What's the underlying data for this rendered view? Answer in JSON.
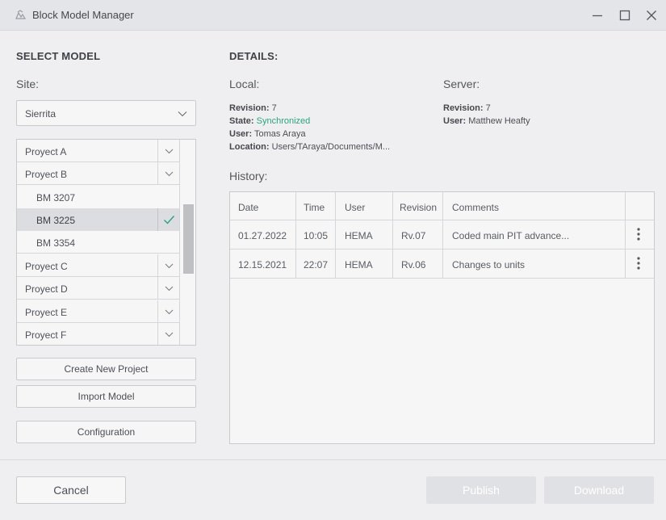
{
  "window": {
    "title": "Block Model Manager"
  },
  "select_model": {
    "heading": "SELECT MODEL",
    "site_label": "Site:",
    "site_value": "Sierrita",
    "tree": [
      {
        "label": "Proyect A",
        "kind": "project"
      },
      {
        "label": "Proyect B",
        "kind": "project",
        "expanded": true
      },
      {
        "label": "BM 3207",
        "kind": "model"
      },
      {
        "label": "BM 3225",
        "kind": "model",
        "selected": true
      },
      {
        "label": "BM 3354",
        "kind": "model"
      },
      {
        "label": "Proyect C",
        "kind": "project"
      },
      {
        "label": "Proyect D",
        "kind": "project"
      },
      {
        "label": "Proyect E",
        "kind": "project"
      },
      {
        "label": "Proyect F",
        "kind": "project"
      }
    ],
    "buttons": {
      "create": "Create New Project",
      "import": "Import Model",
      "config": "Configuration"
    }
  },
  "details": {
    "heading": "DETAILS:",
    "local": {
      "title": "Local:",
      "revision_key": "Revision:",
      "revision": "7",
      "state_key": "State:",
      "state": "Synchronized",
      "user_key": "User:",
      "user": "Tomas Araya",
      "location_key": "Location:",
      "location": "Users/TAraya/Documents/M..."
    },
    "server": {
      "title": "Server:",
      "revision_key": "Revision:",
      "revision": "7",
      "user_key": "User:",
      "user": "Matthew Heafty"
    },
    "history_label": "History:",
    "history": {
      "columns": [
        "Date",
        "Time",
        "User",
        "Revision",
        "Comments"
      ],
      "rows": [
        {
          "date": "01.27.2022",
          "time": "10:05",
          "user": "HEMA",
          "revision": "Rv.07",
          "comment": "Coded main PIT advance..."
        },
        {
          "date": "12.15.2021",
          "time": "22:07",
          "user": "HEMA",
          "revision": "Rv.06",
          "comment": "Changes to units"
        }
      ]
    }
  },
  "footer": {
    "cancel": "Cancel",
    "publish": "Publish",
    "download": "Download"
  },
  "colors": {
    "accent_synced": "#2aa37e",
    "check": "#2aa37e"
  }
}
